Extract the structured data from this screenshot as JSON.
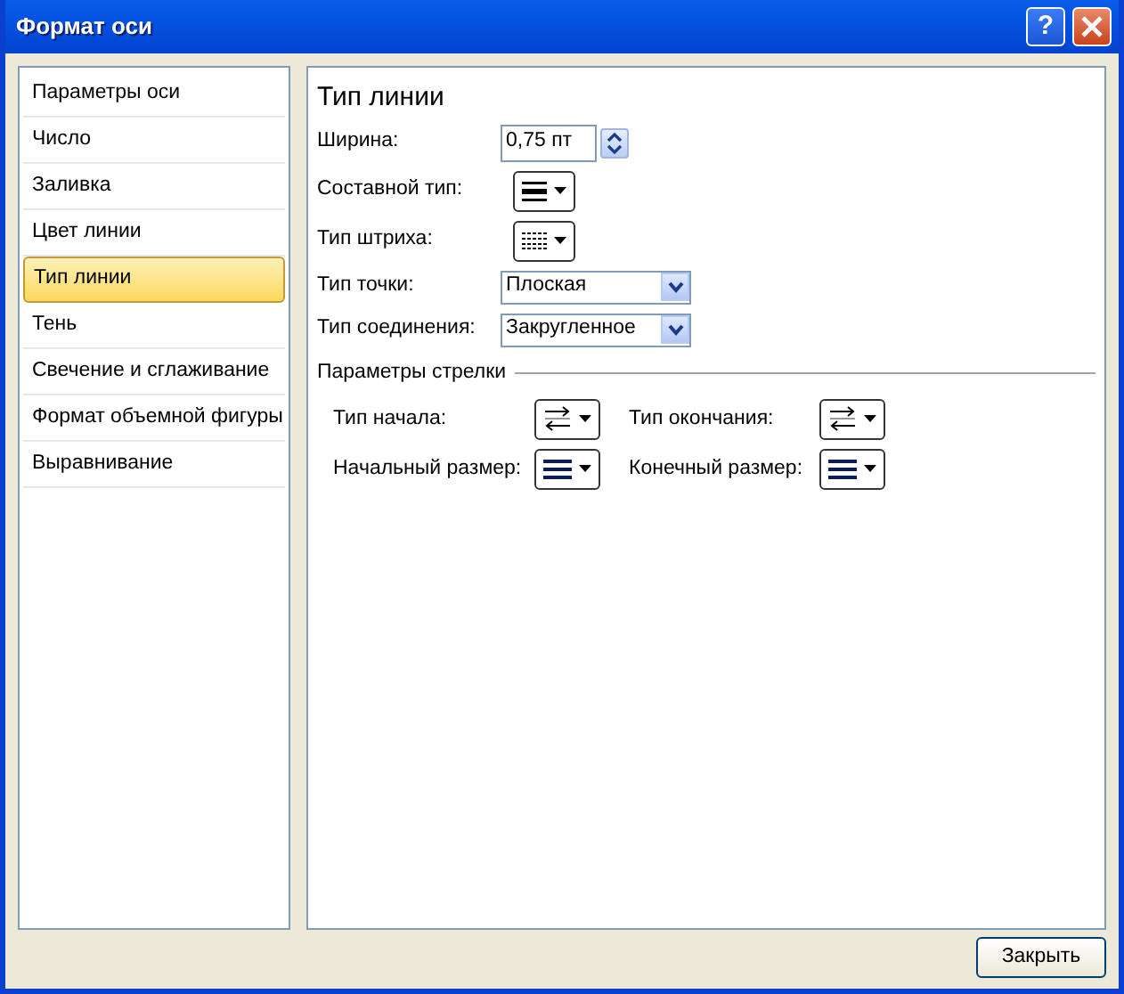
{
  "window": {
    "title": "Формат оси",
    "help_button": "?"
  },
  "sidebar": {
    "items": [
      {
        "label": "Параметры оси",
        "selected": false
      },
      {
        "label": "Число",
        "selected": false
      },
      {
        "label": "Заливка",
        "selected": false
      },
      {
        "label": "Цвет линии",
        "selected": false
      },
      {
        "label": "Тип линии",
        "selected": true
      },
      {
        "label": "Тень",
        "selected": false
      },
      {
        "label": "Свечение и сглаживание",
        "selected": false
      },
      {
        "label": "Формат объемной фигуры",
        "selected": false
      },
      {
        "label": "Выравнивание",
        "selected": false
      }
    ]
  },
  "panel": {
    "title": "Тип линии",
    "fields": [
      {
        "kind": "spin",
        "label": "Ширина:",
        "value": "0,75 пт"
      },
      {
        "kind": "compound-picker",
        "label": "Составной тип:"
      },
      {
        "kind": "dash-picker",
        "label": "Тип штриха:"
      },
      {
        "kind": "select",
        "label": "Тип точки:",
        "value": "Плоская"
      },
      {
        "kind": "select",
        "label": "Тип соединения:",
        "value": "Закругленное"
      }
    ],
    "arrow_section": {
      "title": "Параметры стрелки",
      "fields": [
        {
          "kind": "arrow-type-picker",
          "label": "Тип начала:"
        },
        {
          "kind": "arrow-type-picker",
          "label": "Тип окончания:"
        },
        {
          "kind": "arrow-size-picker",
          "label": "Начальный размер:"
        },
        {
          "kind": "arrow-size-picker",
          "label": "Конечный размер:"
        }
      ]
    }
  },
  "footer": {
    "close_button": "Закрыть"
  }
}
